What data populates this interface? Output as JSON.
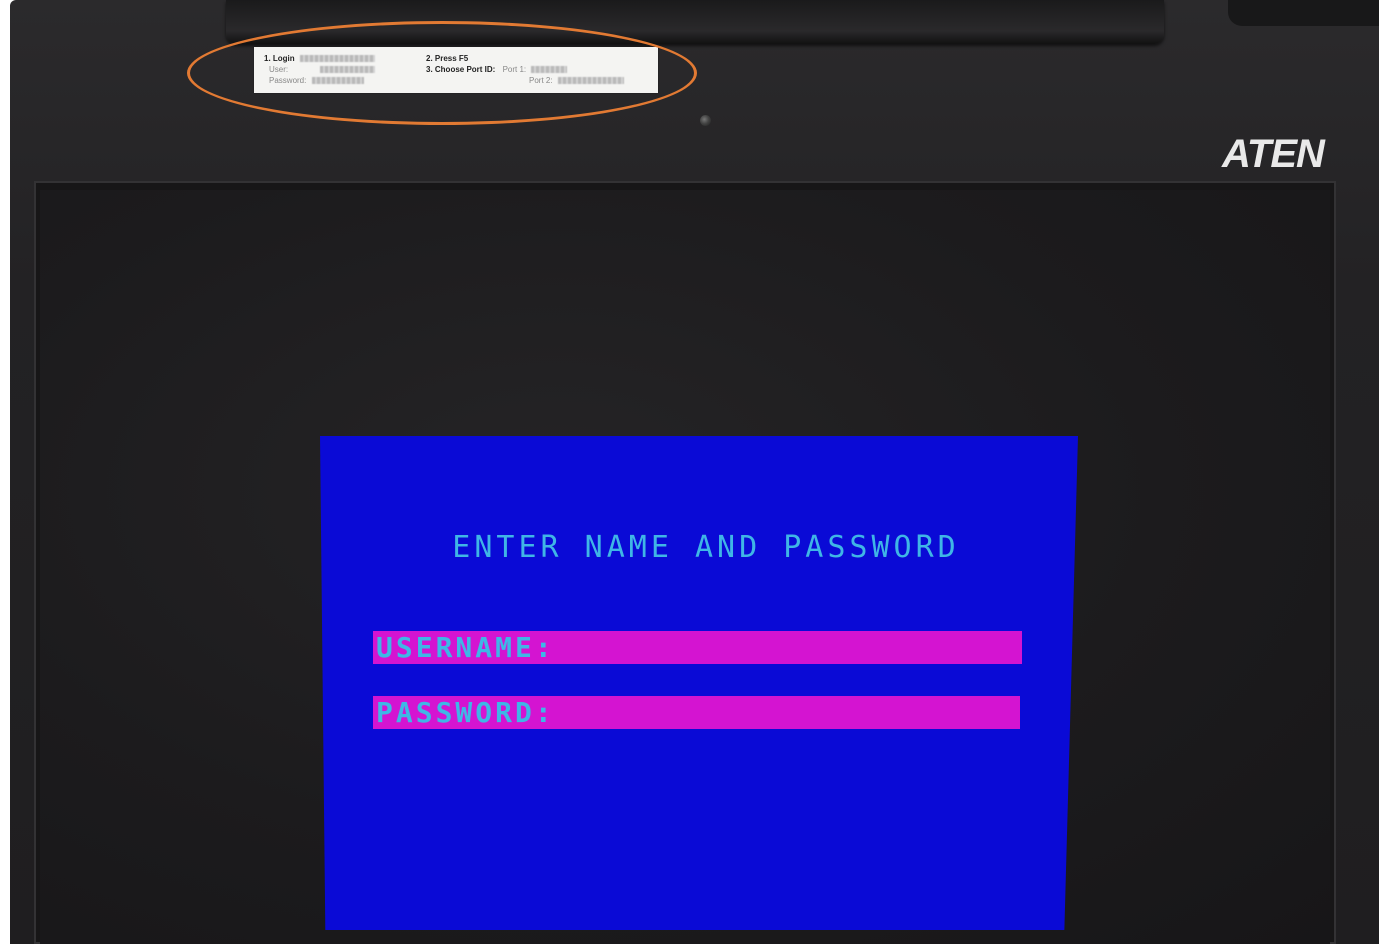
{
  "sticker": {
    "step1": "1. Login",
    "user_label": "User:",
    "password_label": "Password:",
    "step2": "2. Press F5",
    "step3": "3. Choose Port ID:",
    "port1_label": "Port 1:",
    "port2_label": "Port 2:"
  },
  "brand": "ATEN",
  "login": {
    "title": "ENTER NAME AND PASSWORD",
    "username_label": "USERNAME:",
    "password_label": "PASSWORD:"
  },
  "colors": {
    "screen_bg": "#0a0ad6",
    "field_bg": "#d414d1",
    "text": "#3fb6e6",
    "highlight_ring": "#e27a33"
  }
}
